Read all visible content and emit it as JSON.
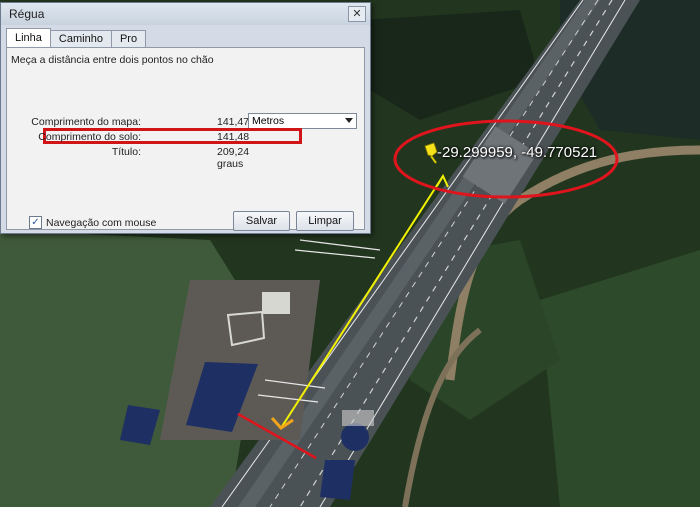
{
  "dialog": {
    "title": "Régua",
    "close_glyph": "✕",
    "tabs": [
      {
        "label": "Linha",
        "active": true
      },
      {
        "label": "Caminho",
        "active": false
      },
      {
        "label": "Pro",
        "active": false
      }
    ],
    "description": "Meça a distância entre dois pontos no chão",
    "map_length": {
      "label": "Comprimento do mapa:",
      "value": "141,47"
    },
    "ground_length": {
      "label": "Comprimento do solo:",
      "value": "141,48"
    },
    "heading": {
      "label": "Título:",
      "value": "209,24 graus"
    },
    "unit_select": {
      "selected": "Metros"
    },
    "mouse_nav": {
      "label": "Navegação com mouse",
      "checked": true,
      "check_glyph": "✓"
    },
    "save_label": "Salvar",
    "clear_label": "Limpar"
  },
  "map": {
    "coordinates_label": "-29.299959, -49.770521",
    "annotation_color": "#e0141c",
    "ruler_color": "#f2f200",
    "pin_color": "#f5e21a",
    "icons": [
      "pushpin-icon",
      "ruler-line",
      "arrow-head-icon"
    ]
  }
}
